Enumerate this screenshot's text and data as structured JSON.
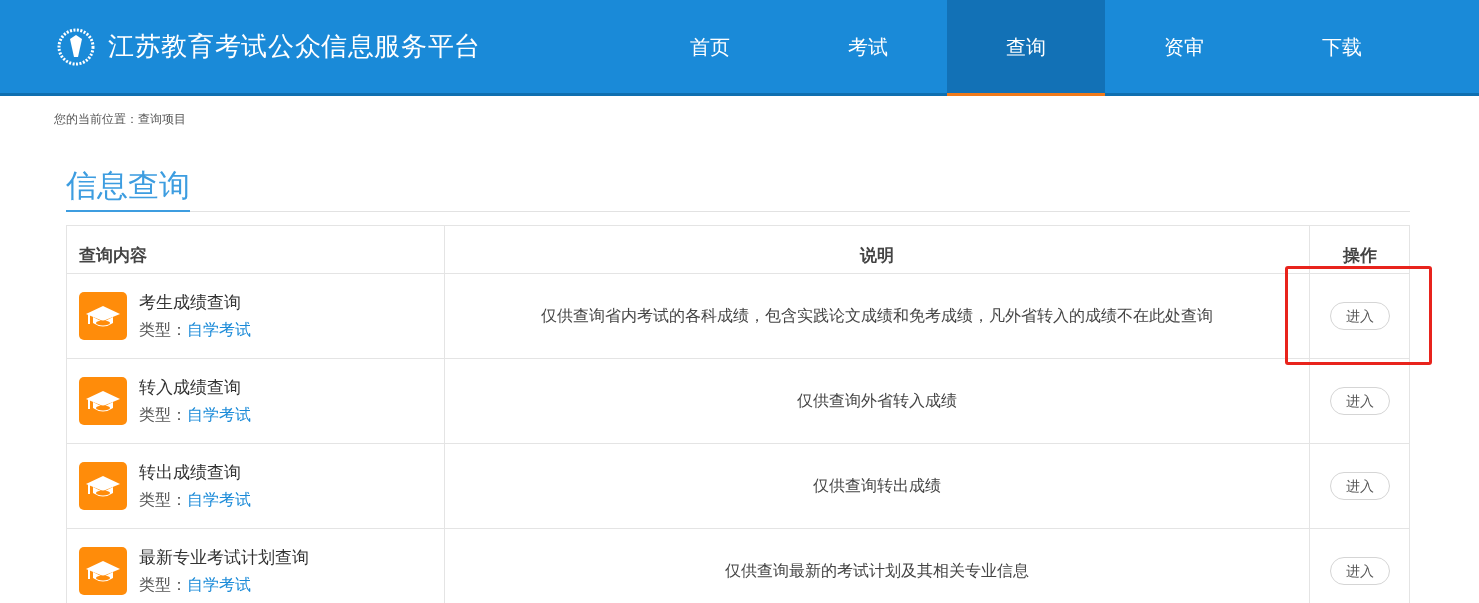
{
  "header": {
    "site_title": "江苏教育考试公众信息服务平台",
    "nav": [
      {
        "label": "首页",
        "selected": false
      },
      {
        "label": "考试",
        "selected": false
      },
      {
        "label": "查询",
        "selected": true
      },
      {
        "label": "资审",
        "selected": false
      },
      {
        "label": "下载",
        "selected": false
      }
    ]
  },
  "breadcrumb": "您的当前位置：查询项目",
  "section_title": "信息查询",
  "table": {
    "columns": [
      "查询内容",
      "说明",
      "操作"
    ],
    "rows": [
      {
        "name": "考生成绩查询",
        "type_label": "类型：",
        "type_value": "自学考试",
        "description": "仅供查询省内考试的各科成绩，包含实践论文成绩和免考成绩，凡外省转入的成绩不在此处查询",
        "action": "进入",
        "highlighted": true
      },
      {
        "name": "转入成绩查询",
        "type_label": "类型：",
        "type_value": "自学考试",
        "description": "仅供查询外省转入成绩",
        "action": "进入",
        "highlighted": false
      },
      {
        "name": "转出成绩查询",
        "type_label": "类型：",
        "type_value": "自学考试",
        "description": "仅供查询转出成绩",
        "action": "进入",
        "highlighted": false
      },
      {
        "name": "最新专业考试计划查询",
        "type_label": "类型：",
        "type_value": "自学考试",
        "description": "仅供查询最新的考试计划及其相关专业信息",
        "action": "进入",
        "highlighted": false
      }
    ]
  }
}
